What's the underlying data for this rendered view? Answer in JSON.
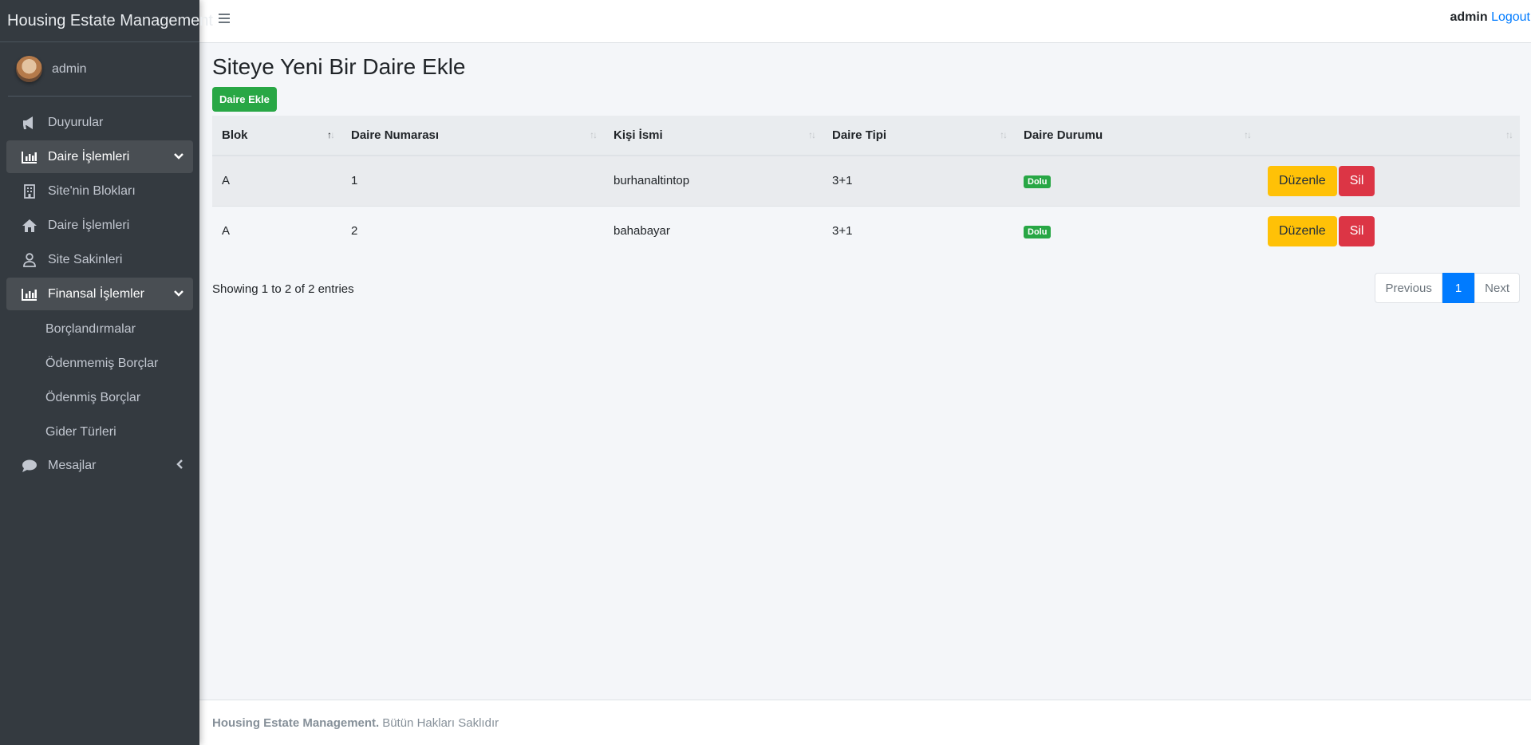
{
  "app": {
    "title": "Housing Estate Management"
  },
  "user": {
    "name": "admin"
  },
  "sidebar": {
    "items": [
      {
        "label": "Duyurular",
        "icon": "megaphone-icon"
      },
      {
        "label": "Daire İşlemleri",
        "icon": "bar-chart-icon",
        "open": true
      },
      {
        "label": "Site'nin Blokları",
        "icon": "building-icon"
      },
      {
        "label": "Daire İşlemleri",
        "icon": "house-icon"
      },
      {
        "label": "Site Sakinleri",
        "icon": "person-icon"
      },
      {
        "label": "Finansal İşlemler",
        "icon": "bar-chart-icon",
        "open": true
      },
      {
        "label": "Borçlandırmalar"
      },
      {
        "label": "Ödenmemiş Borçlar"
      },
      {
        "label": "Ödenmiş Borçlar"
      },
      {
        "label": "Gider Türleri"
      },
      {
        "label": "Mesajlar",
        "icon": "chat-icon"
      }
    ]
  },
  "header": {
    "user_bold": "admin",
    "logout": "Logout"
  },
  "main": {
    "title": "Siteye Yeni Bir Daire Ekle",
    "add_button": "Daire Ekle",
    "columns": [
      "Blok",
      "Daire Numarası",
      "Kişi İsmi",
      "Daire Tipi",
      "Daire Durumu",
      ""
    ],
    "rows": [
      {
        "blok": "A",
        "no": "1",
        "name": "burhanaltintop",
        "type": "3+1",
        "status": "Dolu",
        "edit": "Düzenle",
        "delete": "Sil"
      },
      {
        "blok": "A",
        "no": "2",
        "name": "bahabayar",
        "type": "3+1",
        "status": "Dolu",
        "edit": "Düzenle",
        "delete": "Sil"
      }
    ],
    "info": "Showing 1 to 2 of 2 entries",
    "pagination": {
      "previous": "Previous",
      "page": "1",
      "next": "Next"
    }
  },
  "footer": {
    "brand": "Housing Estate Management.",
    "text": "Bütün Hakları Saklıdır"
  },
  "colors": {
    "sidebar": "#343a40",
    "primary": "#007bff",
    "success": "#28a745",
    "warning": "#ffc107",
    "danger": "#dc3545"
  }
}
